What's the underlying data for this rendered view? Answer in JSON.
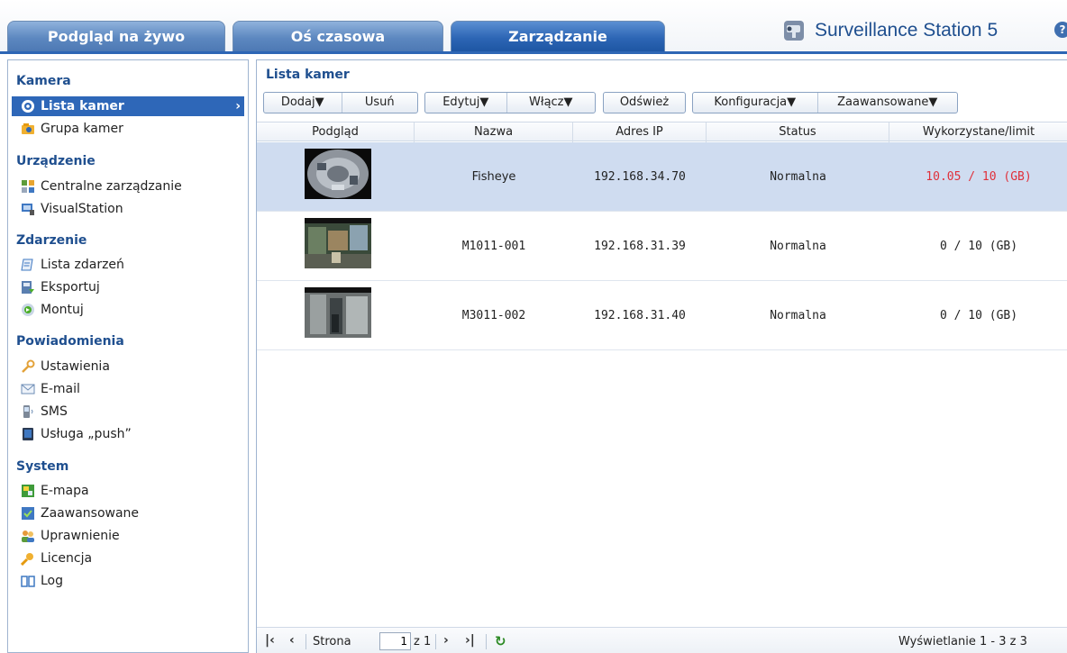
{
  "tabs": [
    {
      "label": "Podgląd na żywo",
      "active": false
    },
    {
      "label": "Oś czasowa",
      "active": false
    },
    {
      "label": "Zarządzanie",
      "active": true
    }
  ],
  "brand": {
    "title": "Surveillance Station 5",
    "help": "?"
  },
  "sidebar": {
    "sections": [
      {
        "title": "Kamera",
        "items": [
          {
            "label": "Lista kamer",
            "icon": "camera-icon",
            "selected": true
          },
          {
            "label": "Grupa kamer",
            "icon": "camera-group-icon"
          }
        ]
      },
      {
        "title": "Urządzenie",
        "items": [
          {
            "label": "Centralne zarządzanie",
            "icon": "central-management-icon"
          },
          {
            "label": "VisualStation",
            "icon": "visualstation-icon"
          }
        ]
      },
      {
        "title": "Zdarzenie",
        "items": [
          {
            "label": "Lista zdarzeń",
            "icon": "event-list-icon"
          },
          {
            "label": "Eksportuj",
            "icon": "export-icon"
          },
          {
            "label": "Montuj",
            "icon": "mount-icon"
          }
        ]
      },
      {
        "title": "Powiadomienia",
        "items": [
          {
            "label": "Ustawienia",
            "icon": "wrench-icon"
          },
          {
            "label": "E-mail",
            "icon": "mail-icon"
          },
          {
            "label": "SMS",
            "icon": "sms-icon"
          },
          {
            "label": "Usługa „push”",
            "icon": "push-service-icon"
          }
        ]
      },
      {
        "title": "System",
        "items": [
          {
            "label": "E-mapa",
            "icon": "emap-icon"
          },
          {
            "label": "Zaawansowane",
            "icon": "advanced-icon"
          },
          {
            "label": "Uprawnienie",
            "icon": "users-icon"
          },
          {
            "label": "Licencja",
            "icon": "key-icon"
          },
          {
            "label": "Log",
            "icon": "log-icon"
          }
        ]
      }
    ]
  },
  "main": {
    "title": "Lista kamer",
    "toolbar": {
      "dodaj": "Dodaj",
      "usun": "Usuń",
      "edytuj": "Edytuj",
      "wlacz": "Włącz",
      "odswiez": "Odśwież",
      "konfiguracja": "Konfiguracja",
      "zaawansowane": "Zaawansowane"
    },
    "columns": [
      "Podgląd",
      "Nazwa",
      "Adres IP",
      "Status",
      "Wykorzystane/limit"
    ],
    "rows": [
      {
        "name": "Fisheye",
        "ip": "192.168.34.70",
        "status": "Normalna",
        "usage": "10.05 / 10 (GB)",
        "over_limit": true,
        "selected": true
      },
      {
        "name": "M1011-001",
        "ip": "192.168.31.39",
        "status": "Normalna",
        "usage": "0 / 10 (GB)",
        "over_limit": false,
        "selected": false
      },
      {
        "name": "M3011-002",
        "ip": "192.168.31.40",
        "status": "Normalna",
        "usage": "0 / 10 (GB)",
        "over_limit": false,
        "selected": false
      }
    ],
    "pager": {
      "page_label": "Strona",
      "page_value": "1",
      "of_label": "z 1",
      "display_info": "Wyświetlanie 1 - 3 z 3"
    }
  },
  "colors": {
    "accent": "#2e67b8",
    "over_limit": "#e0303a",
    "selected_row": "#cfdcf0"
  }
}
